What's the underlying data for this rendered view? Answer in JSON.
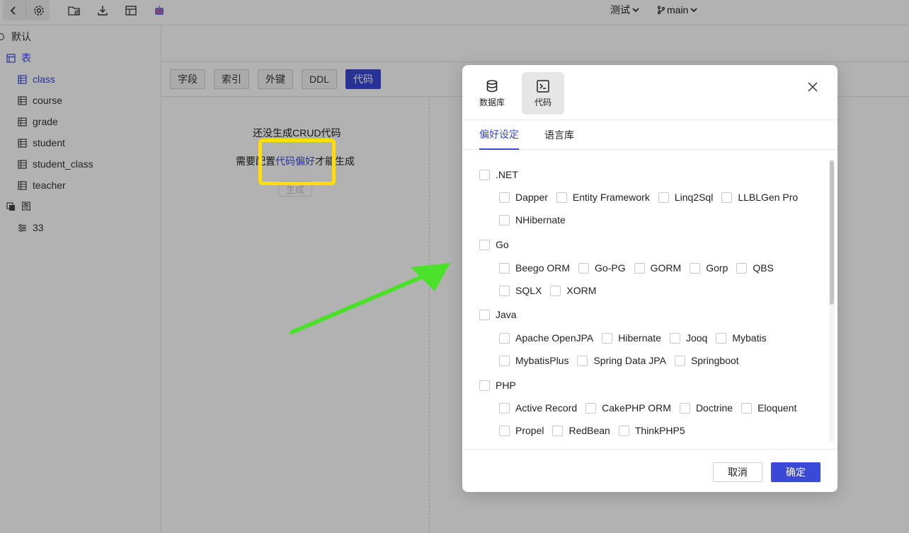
{
  "topbar": {
    "right": {
      "env_label": "测试",
      "branch_label": "main"
    }
  },
  "sidebar": {
    "default_label": "默认",
    "tables_label": "表",
    "tables": [
      "class",
      "course",
      "grade",
      "student",
      "student_class",
      "teacher"
    ],
    "views_label": "图",
    "views": [
      "33"
    ]
  },
  "main": {
    "tabs": [
      "字段",
      "索引",
      "外键",
      "DDL",
      "代码"
    ],
    "active_tab": "代码",
    "empty_title": "还没生成CRUD代码",
    "empty_desc_prefix": "需要配置",
    "empty_desc_link": "代码偏好",
    "empty_desc_suffix": "才能生成",
    "generate_label": "生成"
  },
  "modal": {
    "nav": [
      {
        "label": "数据库",
        "icon": "database-icon"
      },
      {
        "label": "代码",
        "icon": "terminal-icon"
      }
    ],
    "tabs": [
      "偏好设定",
      "语言库"
    ],
    "groups": [
      {
        "name": ".NET",
        "options": [
          "Dapper",
          "Entity Framework",
          "Linq2Sql",
          "LLBLGen Pro",
          "NHibernate"
        ]
      },
      {
        "name": "Go",
        "options": [
          "Beego ORM",
          "Go-PG",
          "GORM",
          "Gorp",
          "QBS",
          "SQLX",
          "XORM"
        ]
      },
      {
        "name": "Java",
        "options": [
          "Apache OpenJPA",
          "Hibernate",
          "Jooq",
          "Mybatis",
          "MybatisPlus",
          "Spring Data JPA",
          "Springboot"
        ]
      },
      {
        "name": "PHP",
        "options": [
          "Active Record",
          "CakePHP ORM",
          "Doctrine",
          "Eloquent",
          "Propel",
          "RedBean",
          "ThinkPHP5"
        ]
      }
    ],
    "cancel_label": "取消",
    "ok_label": "确定"
  },
  "colors": {
    "accent": "#3b4ad6",
    "highlight": "#ffe000",
    "arrow": "#4be02a"
  }
}
